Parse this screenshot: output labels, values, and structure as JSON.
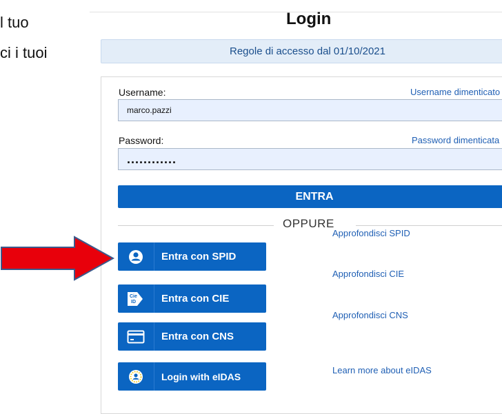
{
  "side_text": {
    "line1": "l tuo",
    "line2": "ci i tuoi"
  },
  "title": "Login",
  "rules_banner": "Regole di accesso dal 01/10/2021",
  "username": {
    "label": "Username:",
    "forgot": "Username dimenticato",
    "value": "marco.pazzi"
  },
  "password": {
    "label": "Password:",
    "forgot": "Password dimenticata",
    "value": "............"
  },
  "submit_label": "ENTRA",
  "separator_label": "OPPURE",
  "auth_options": [
    {
      "label": "Entra con SPID",
      "icon": "user-circle-icon",
      "learn_more": "Approfondisci SPID"
    },
    {
      "label": "Entra con CIE",
      "icon": "cie-icon",
      "learn_more": "Approfondisci CIE"
    },
    {
      "label": "Entra con CNS",
      "icon": "card-icon",
      "learn_more": "Approfondisci CNS"
    },
    {
      "label": "Login with eIDAS",
      "icon": "eidas-user-icon",
      "learn_more": "Learn more about eIDAS"
    }
  ],
  "colors": {
    "primary": "#0b65c2",
    "link": "#1f5fb4",
    "banner_bg": "#e3edf8",
    "field_bg": "#e8f0fe",
    "arrow": "#e8000b"
  }
}
